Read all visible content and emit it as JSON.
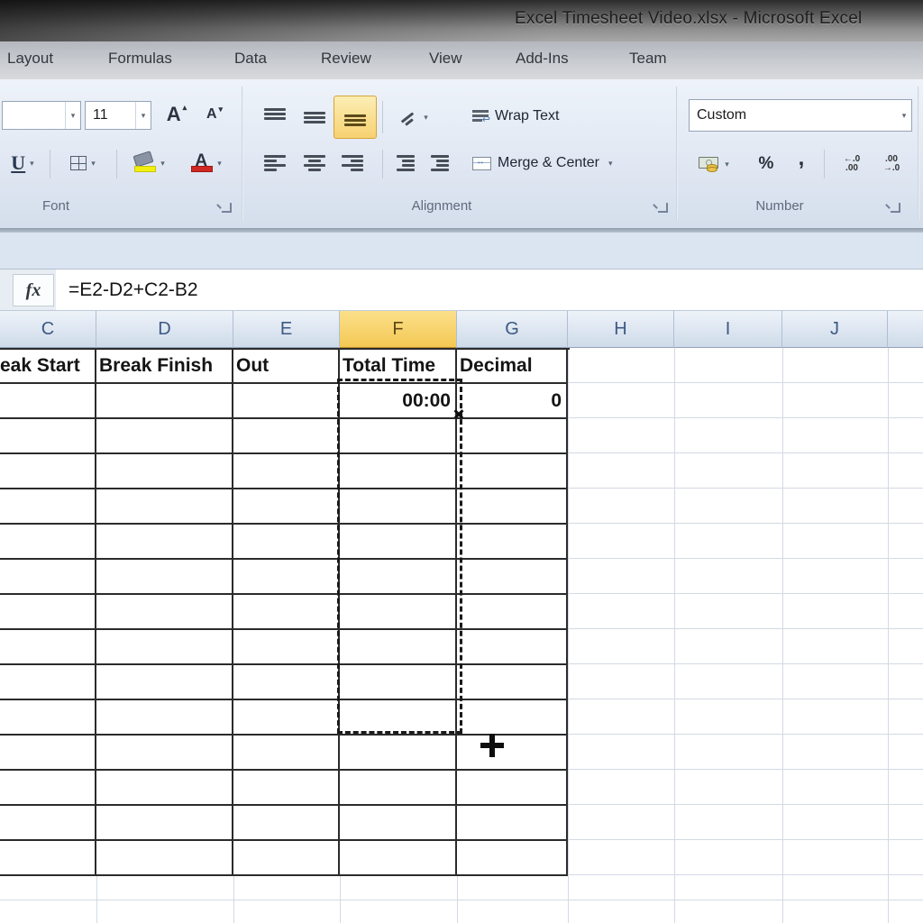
{
  "window": {
    "title": "Excel Timesheet Video.xlsx  -  Microsoft Excel"
  },
  "tabs": [
    "Layout",
    "Formulas",
    "Data",
    "Review",
    "View",
    "Add-Ins",
    "Team"
  ],
  "ribbon": {
    "font": {
      "label": "Font",
      "size_value": "11",
      "underline_label": "U",
      "grow_font_label": "A",
      "shrink_font_label": "A",
      "font_color_letter": "A"
    },
    "alignment": {
      "label": "Alignment",
      "wrap_text_label": "Wrap Text",
      "merge_center_label": "Merge & Center"
    },
    "number": {
      "label": "Number",
      "format_value": "Custom",
      "percent": "%",
      "comma": ",",
      "inc_decimal_top": "←.0",
      "inc_decimal_bottom": ".00",
      "dec_decimal_top": ".00",
      "dec_decimal_bottom": "→.0"
    }
  },
  "formula_bar": {
    "fx_label": "fx",
    "formula": "=E2-D2+C2-B2"
  },
  "sheet": {
    "column_letters": [
      "C",
      "D",
      "E",
      "F",
      "G",
      "H",
      "I",
      "J"
    ],
    "selected_column": "F",
    "table_headers": [
      "eak Start",
      "Break Finish",
      "Out",
      "Total Time",
      "Decimal"
    ],
    "row2_values": {
      "total_time": "00:00",
      "decimal": "0"
    }
  },
  "colors": {
    "selected_header": "#f4c854",
    "highlighted_align_button": "#f7d171",
    "fill_color_swatch": "#f3ef0c",
    "font_color_swatch": "#d02822",
    "marquee": "#1a1a1a",
    "table_border": "#2b2b2b",
    "gridline": "#d3dae4"
  }
}
